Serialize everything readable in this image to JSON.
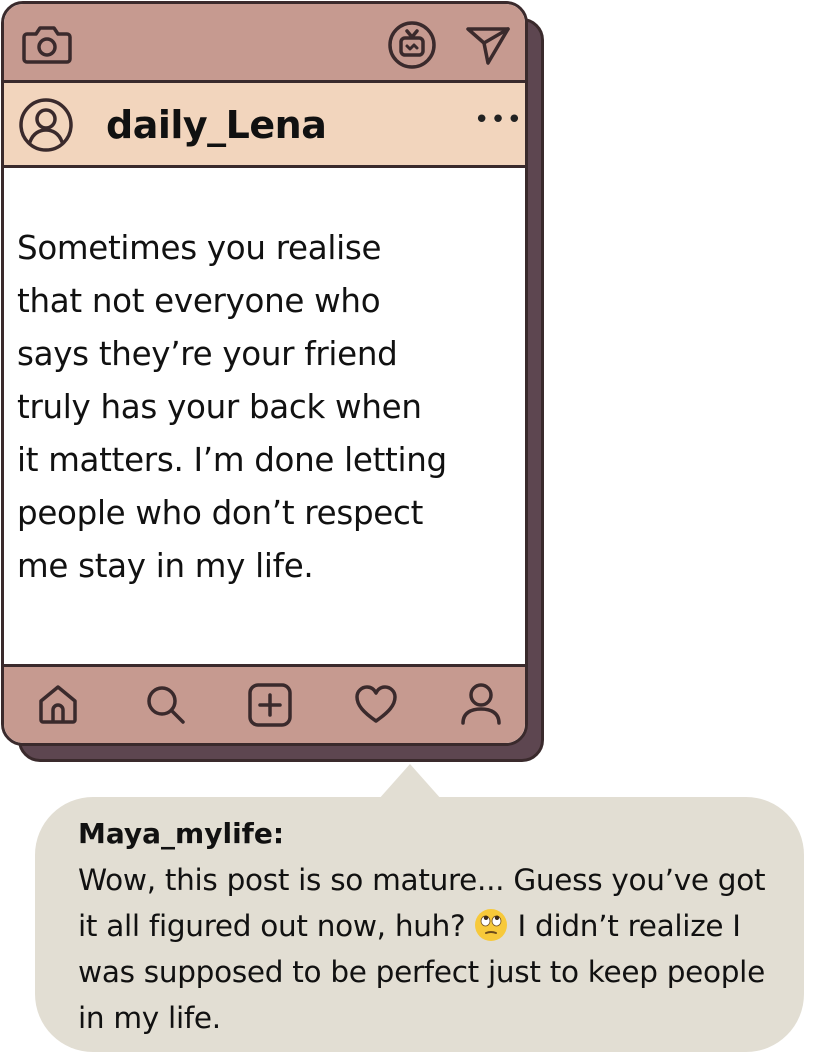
{
  "post": {
    "username": "daily_Lena",
    "more_label": "•••",
    "text": "Sometimes you realise\nthat not everyone who\nsays they’re your friend\ntruly has your back when\nit matters. I’m done letting\npeople who don’t respect\nme stay in my life."
  },
  "top_icons": [
    "camera-icon",
    "igtv-icon",
    "send-icon"
  ],
  "bottom_nav": [
    "home-icon",
    "search-icon",
    "add-post-icon",
    "heart-icon",
    "profile-icon"
  ],
  "comment": {
    "author": "Maya_mylife:",
    "text_before_emoji": "Wow, this post is so mature... Guess you’ve got it all figured out now, huh?",
    "emoji": "face-with-rolling-eyes",
    "text_after_emoji": "I didn’t realize I was supposed to be perfect just to keep people in my life."
  },
  "colors": {
    "bar": "#c69a90",
    "profile_bar": "#f2d5bd",
    "outline": "#3a2a2c",
    "shadow": "#5d4650",
    "bubble": "#e2ded3"
  }
}
